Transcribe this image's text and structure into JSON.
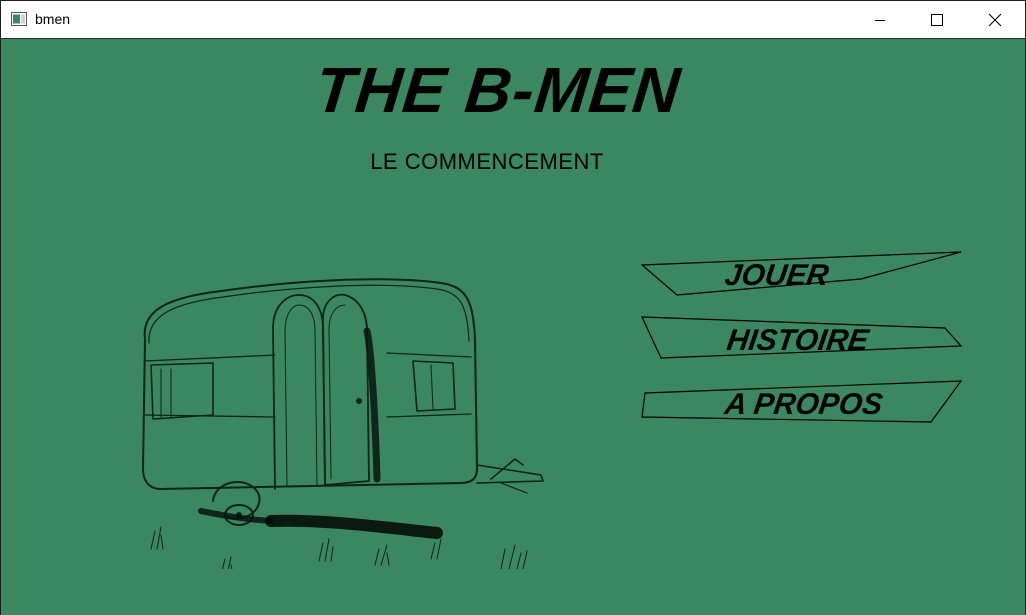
{
  "window": {
    "title": "bmen",
    "controls": {
      "minimize": "minimize-icon",
      "maximize": "maximize-icon",
      "close": "close-icon"
    }
  },
  "colors": {
    "background": "#3a8760",
    "ink": "#000000"
  },
  "game": {
    "title": "THE B-MEN",
    "subtitle": "LE COMMENCEMENT"
  },
  "menu": {
    "items": [
      {
        "label": "JOUER"
      },
      {
        "label": "HISTOIRE"
      },
      {
        "label": "A PROPOS"
      }
    ]
  },
  "illustration": "caravan-sketch"
}
